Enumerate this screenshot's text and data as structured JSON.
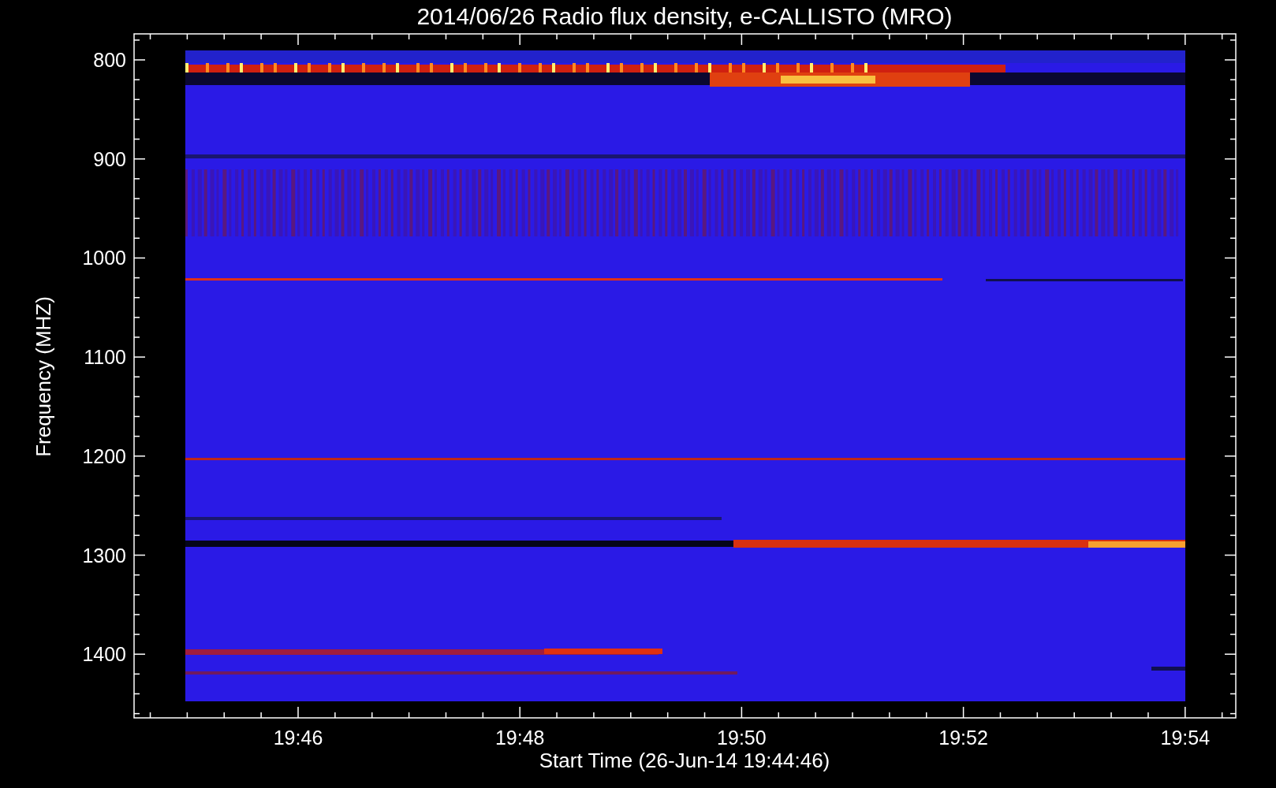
{
  "plot": {
    "title": "2014/06/26  Radio flux density, e-CALLISTO (MRO)",
    "ylabel": "Frequency (MHZ)",
    "xlabel": "Start Time (26-Jun-14 19:44:46)",
    "yticks": [
      "800",
      "900",
      "1000",
      "1100",
      "1200",
      "1300",
      "1400"
    ],
    "xticks": [
      "19:46",
      "19:48",
      "19:50",
      "19:52",
      "19:54"
    ]
  }
}
